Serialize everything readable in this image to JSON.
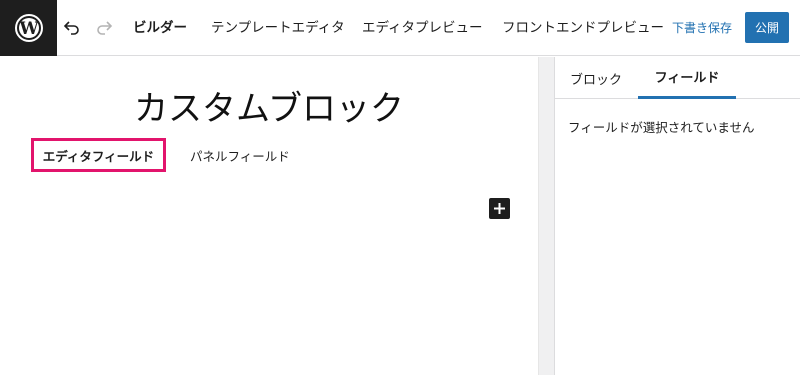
{
  "toolbar": {
    "logo": "wordpress-icon",
    "undo_icon": "undo-icon",
    "redo_icon": "redo-icon",
    "tabs": [
      {
        "label": "ビルダー",
        "active": true
      },
      {
        "label": "テンプレートエディタ",
        "active": false
      },
      {
        "label": "エディタプレビュー",
        "active": false
      },
      {
        "label": "フロントエンドプレビュー",
        "active": false
      }
    ],
    "draft_label": "下書き保存",
    "publish_label": "公開"
  },
  "canvas": {
    "block_title": "カスタムブロック",
    "field_tabs": [
      {
        "label": "エディタフィールド",
        "active": true
      },
      {
        "label": "パネルフィールド",
        "active": false
      }
    ],
    "add_icon": "plus-icon"
  },
  "sidebar": {
    "tabs": [
      {
        "label": "ブロック",
        "active": false
      },
      {
        "label": "フィールド",
        "active": true
      }
    ],
    "message": "フィールドが選択されていません"
  },
  "colors": {
    "accent": "#2271b1",
    "highlight": "#e2146c",
    "dark": "#1e1e1e"
  }
}
